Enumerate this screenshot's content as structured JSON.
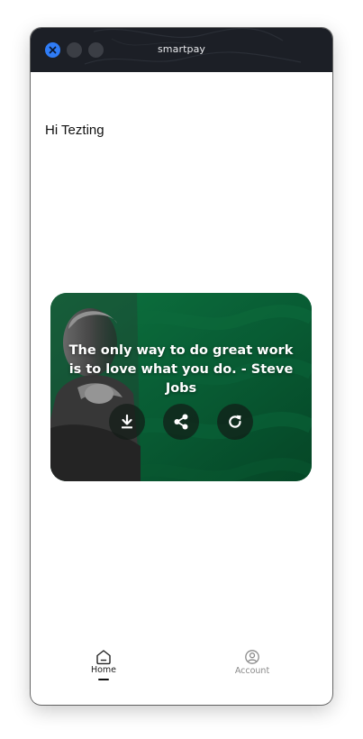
{
  "window": {
    "title": "smartpay"
  },
  "greeting": "Hi Tezting",
  "quote_card": {
    "quote": "The only way to do great work is to love what you do. - Steve Jobs",
    "actions": [
      {
        "name": "download",
        "icon": "download-icon"
      },
      {
        "name": "share",
        "icon": "share-icon"
      },
      {
        "name": "refresh",
        "icon": "refresh-icon"
      }
    ],
    "accent_color": "#0a6a3a"
  },
  "bottom_nav": {
    "items": [
      {
        "label": "Home",
        "icon": "home-icon",
        "active": true
      },
      {
        "label": "Account",
        "icon": "account-icon",
        "active": false
      }
    ]
  },
  "colors": {
    "titlebar": "#1c1f26",
    "close_button": "#2f7cf6"
  }
}
